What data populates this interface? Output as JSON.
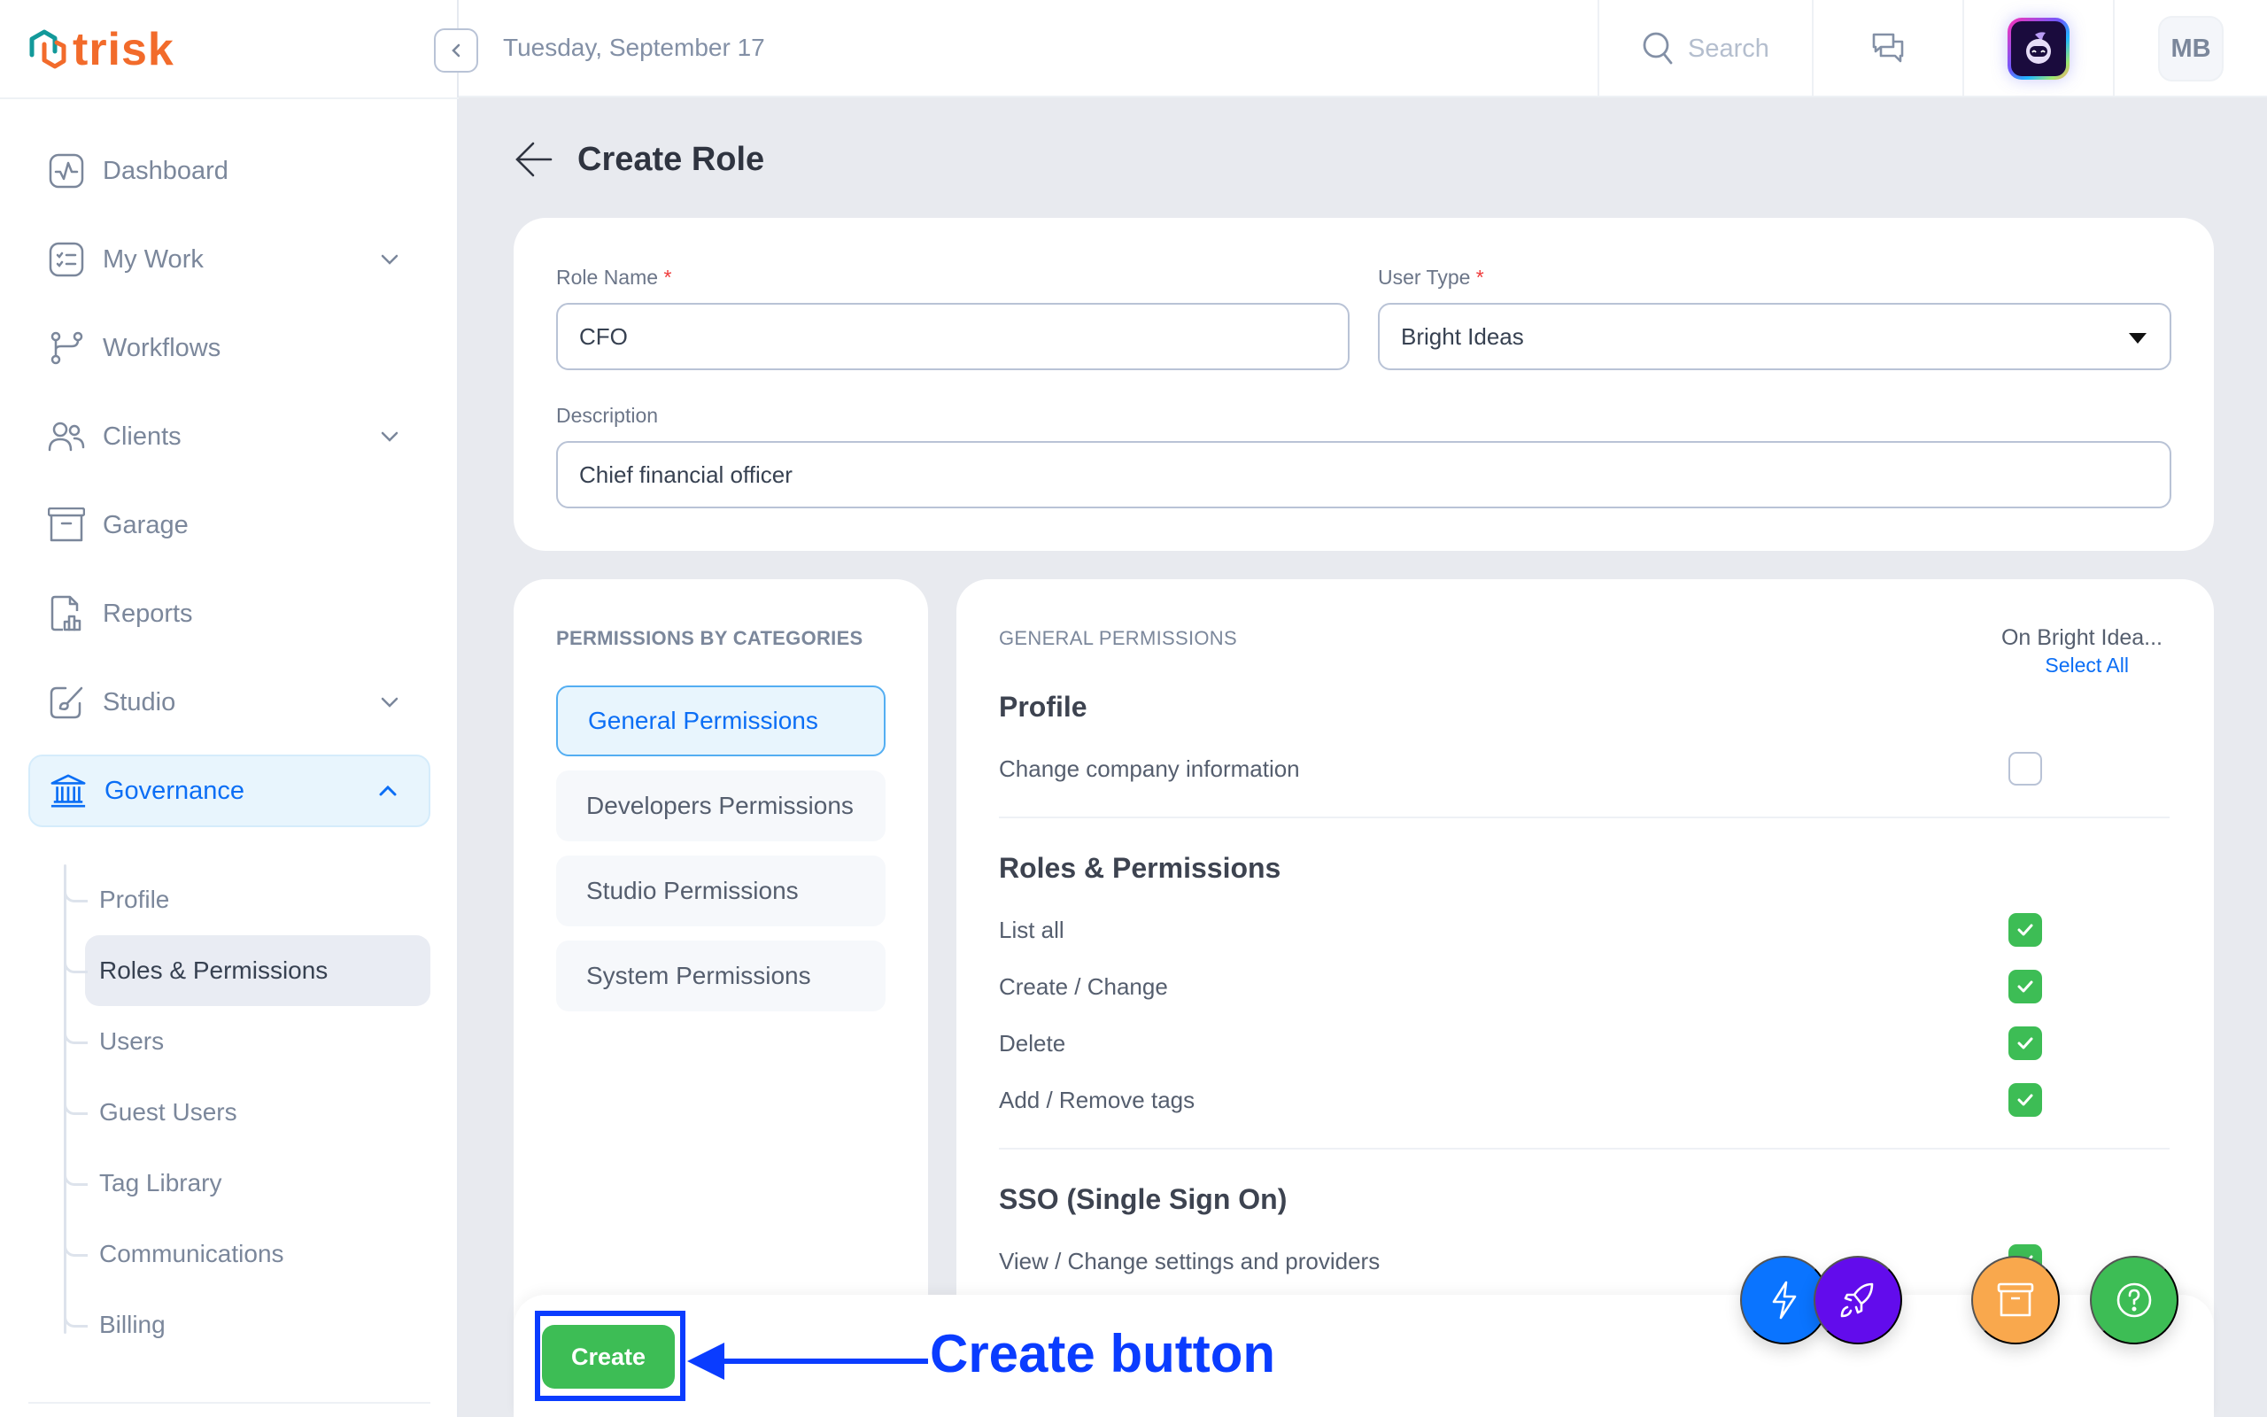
{
  "app": {
    "brand": "trisk",
    "date": "Tuesday, September 17"
  },
  "topbar": {
    "search_placeholder": "Search",
    "avatar_initials": "MB"
  },
  "sidebar": {
    "items": [
      {
        "label": "Dashboard",
        "icon": "dashboard-icon",
        "has_chevron": false
      },
      {
        "label": "My Work",
        "icon": "checklist-icon",
        "has_chevron": true
      },
      {
        "label": "Workflows",
        "icon": "git-branch-icon",
        "has_chevron": false
      },
      {
        "label": "Clients",
        "icon": "users-icon",
        "has_chevron": true
      },
      {
        "label": "Garage",
        "icon": "archive-icon",
        "has_chevron": false
      },
      {
        "label": "Reports",
        "icon": "report-icon",
        "has_chevron": false
      },
      {
        "label": "Studio",
        "icon": "brush-icon",
        "has_chevron": true
      },
      {
        "label": "Governance",
        "icon": "bank-icon",
        "has_chevron": true,
        "expanded": true,
        "active": true
      }
    ],
    "sub_items": [
      {
        "label": "Profile"
      },
      {
        "label": "Roles & Permissions",
        "active": true
      },
      {
        "label": "Users"
      },
      {
        "label": "Guest Users"
      },
      {
        "label": "Tag Library"
      },
      {
        "label": "Communications"
      },
      {
        "label": "Billing"
      }
    ]
  },
  "page": {
    "title": "Create Role",
    "form": {
      "role_name_label": "Role Name",
      "role_name_value": "CFO",
      "user_type_label": "User Type",
      "user_type_value": "Bright Ideas",
      "description_label": "Description",
      "description_value": "Chief financial officer",
      "required_marker": "*"
    },
    "categories": {
      "heading": "PERMISSIONS BY CATEGORIES",
      "items": [
        {
          "label": "General Permissions",
          "active": true
        },
        {
          "label": "Developers Permissions"
        },
        {
          "label": "Studio Permissions"
        },
        {
          "label": "System Permissions"
        }
      ]
    },
    "permissions": {
      "heading": "GENERAL PERMISSIONS",
      "scope_label": "On Bright Idea...",
      "select_all": "Select All",
      "groups": [
        {
          "title": "Profile",
          "rows": [
            {
              "label": "Change company information",
              "checked": false
            }
          ]
        },
        {
          "title": "Roles & Permissions",
          "rows": [
            {
              "label": "List all",
              "checked": true
            },
            {
              "label": "Create / Change",
              "checked": true
            },
            {
              "label": "Delete",
              "checked": true
            },
            {
              "label": "Add / Remove tags",
              "checked": true
            }
          ]
        },
        {
          "title": "SSO (Single Sign On)",
          "rows": [
            {
              "label": "View / Change settings and providers",
              "checked": true
            }
          ]
        }
      ]
    },
    "actions": {
      "create_label": "Create"
    },
    "annotation": {
      "text": "Create button",
      "color": "#0a3cff"
    }
  },
  "fabs": [
    {
      "name": "quick-actions",
      "icon": "bolt-icon",
      "color": "#0a74ff"
    },
    {
      "name": "launch",
      "icon": "rocket-icon",
      "color": "#620cec"
    },
    {
      "name": "archive",
      "icon": "archive-icon",
      "color": "#f9a84d"
    },
    {
      "name": "help",
      "icon": "help-icon",
      "color": "#3dbd55"
    }
  ],
  "colors": {
    "accent": "#0b6ef5",
    "success": "#3dbd55",
    "brand_orange": "#f26b2b",
    "brand_teal": "#12999a"
  }
}
